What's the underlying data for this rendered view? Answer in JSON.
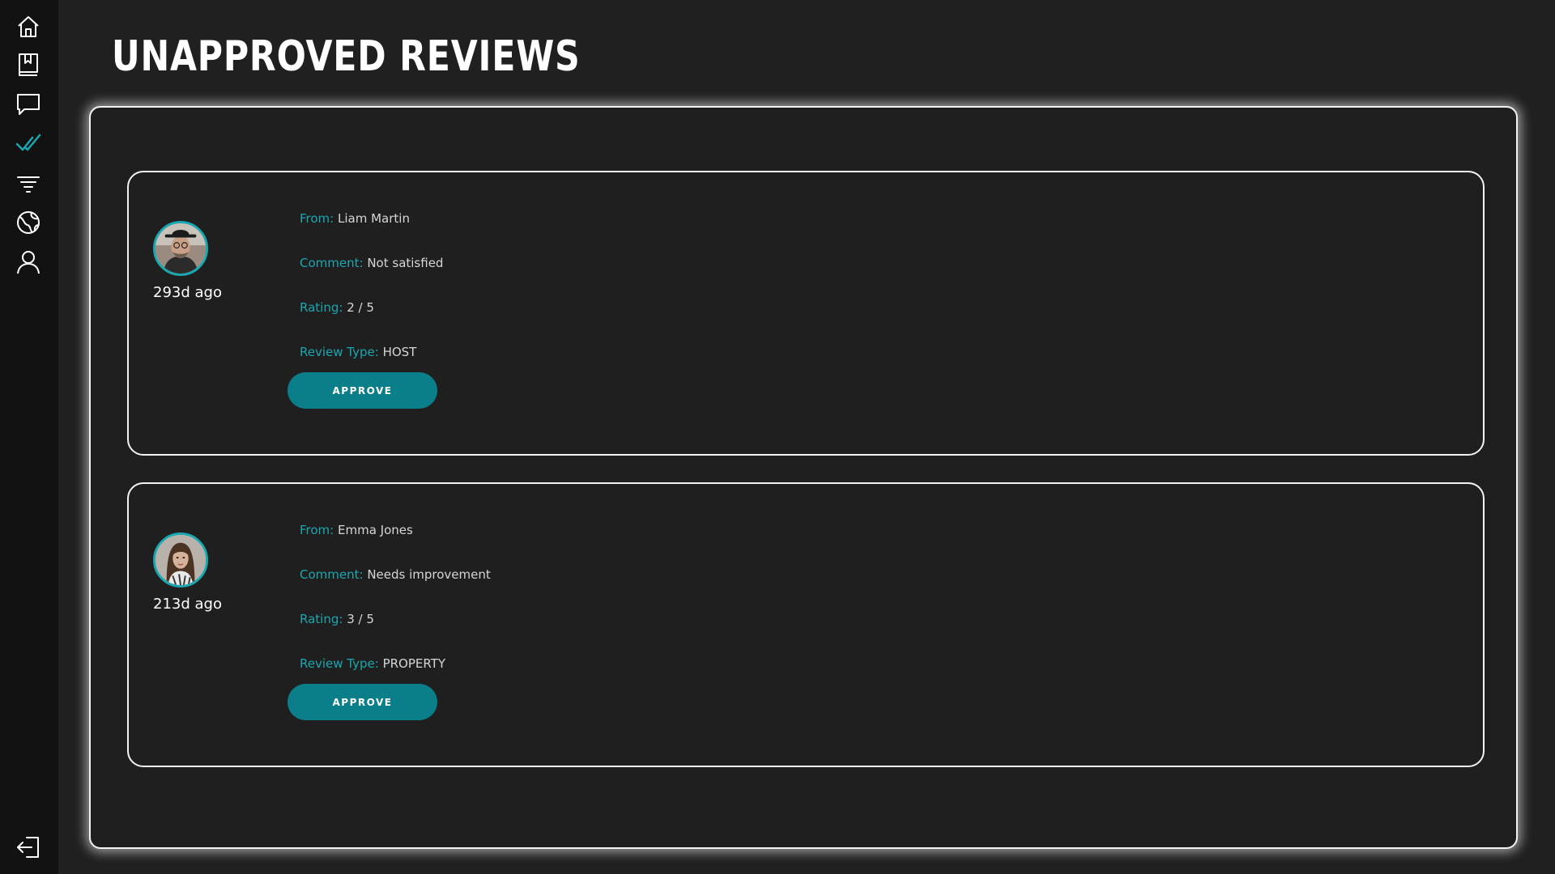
{
  "page": {
    "title": "UNAPPROVED REVIEWS"
  },
  "sidebar": {
    "items": [
      {
        "icon": "home-icon",
        "active": false
      },
      {
        "icon": "bookmark-book-icon",
        "active": false
      },
      {
        "icon": "chat-bubble-icon",
        "active": false
      },
      {
        "icon": "checkmark-icon",
        "active": true
      },
      {
        "icon": "filter-icon",
        "active": false
      },
      {
        "icon": "globe-icon",
        "active": false
      },
      {
        "icon": "user-icon",
        "active": false
      }
    ],
    "logout_icon": "logout-icon"
  },
  "colors": {
    "accent": "#1aa7b0",
    "button": "#0a7f8a",
    "background": "#202020",
    "sidebar": "#121212"
  },
  "reviews": [
    {
      "time_ago": "293d ago",
      "from_label": "From:",
      "from": "Liam Martin",
      "comment_label": "Comment:",
      "comment": "Not satisfied",
      "rating_label": "Rating:",
      "rating": "2 / 5",
      "type_label": "Review Type:",
      "type": "HOST",
      "approve_label": "APPROVE"
    },
    {
      "time_ago": "213d ago",
      "from_label": "From:",
      "from": "Emma Jones",
      "comment_label": "Comment:",
      "comment": "Needs improvement",
      "rating_label": "Rating:",
      "rating": "3 / 5",
      "type_label": "Review Type:",
      "type": "PROPERTY",
      "approve_label": "APPROVE"
    }
  ]
}
